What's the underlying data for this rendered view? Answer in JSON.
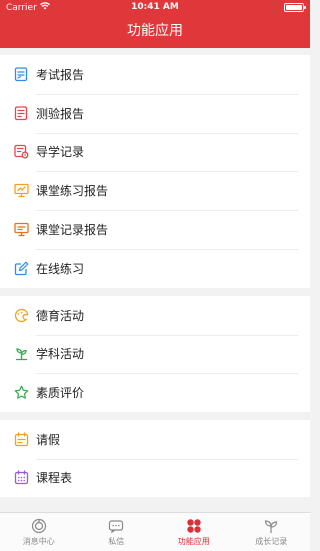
{
  "status_bar": {
    "carrier": "Carrier",
    "time": "10:41 AM"
  },
  "header": {
    "title": "功能应用"
  },
  "groups": [
    {
      "items": [
        {
          "label": "考试报告",
          "icon": "exam-report-icon",
          "color": "#2f8de4"
        },
        {
          "label": "测验报告",
          "icon": "quiz-report-icon",
          "color": "#e0474c"
        },
        {
          "label": "导学记录",
          "icon": "guide-record-icon",
          "color": "#e0474c"
        },
        {
          "label": "课堂练习报告",
          "icon": "class-practice-icon",
          "color": "#f0a21d"
        },
        {
          "label": "课堂记录报告",
          "icon": "class-record-icon",
          "color": "#e86f1c"
        },
        {
          "label": "在线练习",
          "icon": "online-practice-icon",
          "color": "#2f8de4"
        }
      ]
    },
    {
      "items": [
        {
          "label": "德育活动",
          "icon": "moral-activity-icon",
          "color": "#f0a21d"
        },
        {
          "label": "学科活动",
          "icon": "subject-activity-icon",
          "color": "#2eaa4a"
        },
        {
          "label": "素质评价",
          "icon": "quality-eval-icon",
          "color": "#2eaa4a"
        }
      ]
    },
    {
      "items": [
        {
          "label": "请假",
          "icon": "leave-icon",
          "color": "#f0a21d"
        },
        {
          "label": "课程表",
          "icon": "schedule-icon",
          "color": "#9b5bd6"
        }
      ]
    }
  ],
  "tabs": [
    {
      "label": "消息中心",
      "icon": "message-center-icon",
      "active": false
    },
    {
      "label": "私信",
      "icon": "private-message-icon",
      "active": false
    },
    {
      "label": "功能应用",
      "icon": "apps-icon",
      "active": true
    },
    {
      "label": "成长记录",
      "icon": "growth-record-icon",
      "active": false
    }
  ],
  "colors": {
    "primary": "#e0373a",
    "active_tab": "#d9313a",
    "inactive_tab": "#8a8a8a"
  }
}
